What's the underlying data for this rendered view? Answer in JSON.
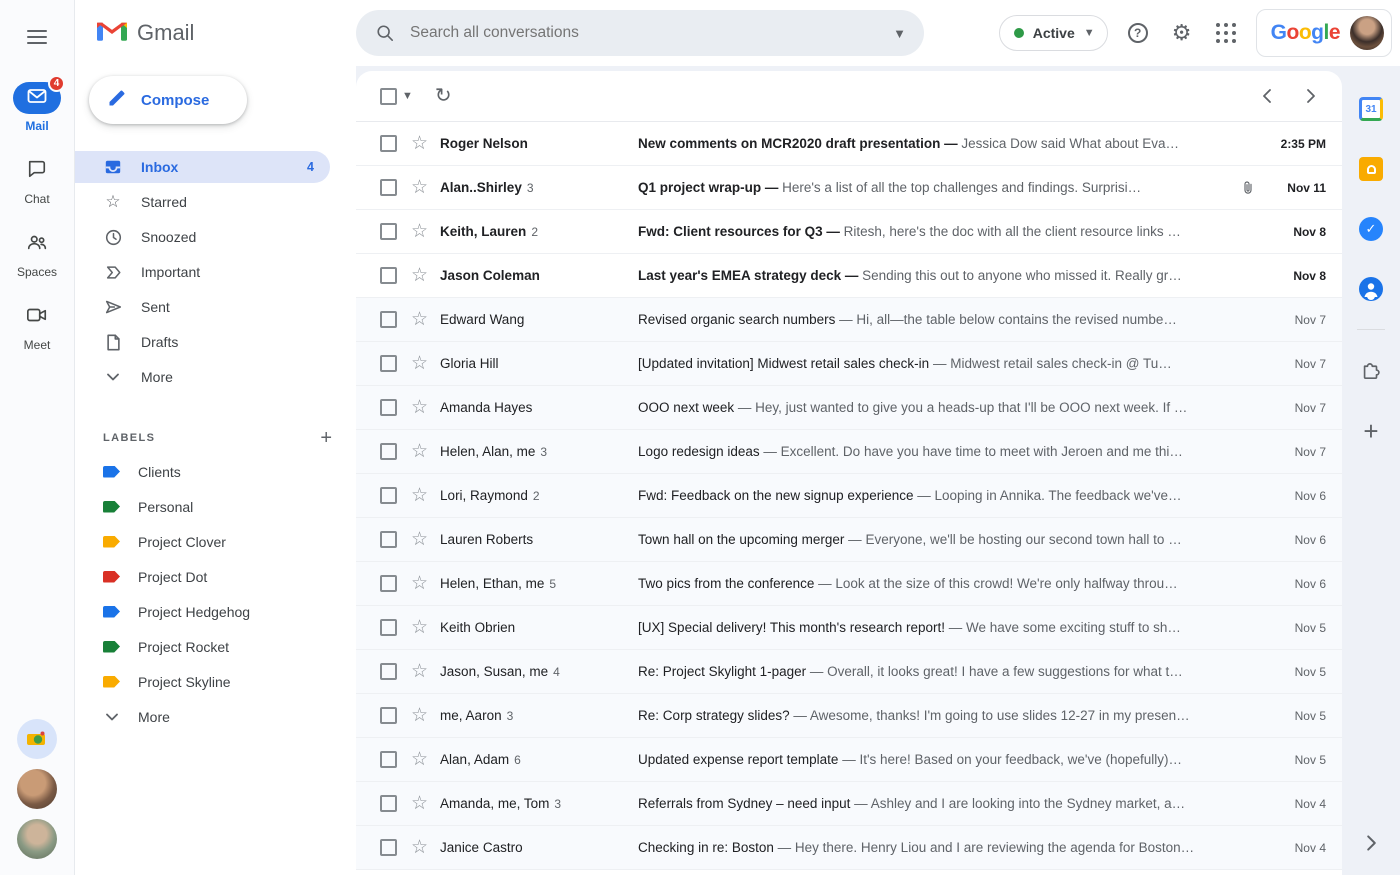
{
  "left_rail": {
    "nav": [
      {
        "id": "mail",
        "label": "Mail",
        "badge": "4",
        "active": true
      },
      {
        "id": "chat",
        "label": "Chat",
        "active": false
      },
      {
        "id": "spaces",
        "label": "Spaces",
        "active": false
      },
      {
        "id": "meet",
        "label": "Meet",
        "active": false
      }
    ]
  },
  "sidebar": {
    "brand": "Gmail",
    "compose_label": "Compose",
    "folders": [
      {
        "label": "Inbox",
        "count": "4",
        "active": true
      },
      {
        "label": "Starred"
      },
      {
        "label": "Snoozed"
      },
      {
        "label": "Important"
      },
      {
        "label": "Sent"
      },
      {
        "label": "Drafts"
      },
      {
        "label": "More"
      }
    ],
    "labels_header": "LABELS",
    "labels": [
      {
        "name": "Clients",
        "color": "#1a73e8"
      },
      {
        "name": "Personal",
        "color": "#188038"
      },
      {
        "name": "Project Clover",
        "color": "#f9ab00"
      },
      {
        "name": "Project Dot",
        "color": "#d93025"
      },
      {
        "name": "Project Hedgehog",
        "color": "#1a73e8"
      },
      {
        "name": "Project Rocket",
        "color": "#188038"
      },
      {
        "name": "Project Skyline",
        "color": "#f9ab00"
      }
    ],
    "labels_more": "More"
  },
  "header": {
    "search_placeholder": "Search all conversations",
    "status_label": "Active",
    "google_letters": [
      {
        "ch": "G",
        "color": "#4285f4"
      },
      {
        "ch": "o",
        "color": "#ea4335"
      },
      {
        "ch": "o",
        "color": "#fbbc05"
      },
      {
        "ch": "g",
        "color": "#4285f4"
      },
      {
        "ch": "l",
        "color": "#34a853"
      },
      {
        "ch": "e",
        "color": "#ea4335"
      }
    ]
  },
  "list": {
    "separator": "—",
    "emails": [
      {
        "sender": "Roger Nelson",
        "count": "",
        "subject": "New comments on MCR2020 draft presentation",
        "snippet": "Jessica Dow said What about Eva…",
        "date": "2:35 PM",
        "unread": true,
        "attachment": false
      },
      {
        "sender": "Alan..Shirley",
        "count": "3",
        "subject": "Q1 project wrap-up",
        "snippet": "Here's a list of all the top challenges and findings. Surprisi…",
        "date": "Nov 11",
        "unread": true,
        "attachment": true
      },
      {
        "sender": "Keith, Lauren",
        "count": "2",
        "subject": "Fwd: Client resources for Q3",
        "snippet": "Ritesh, here's the doc with all the client resource links …",
        "date": "Nov 8",
        "unread": true,
        "attachment": false
      },
      {
        "sender": "Jason Coleman",
        "count": "",
        "subject": "Last year's EMEA strategy deck",
        "snippet": "Sending this out to anyone who missed it. Really gr…",
        "date": "Nov 8",
        "unread": true,
        "attachment": false
      },
      {
        "sender": "Edward Wang",
        "count": "",
        "subject": "Revised organic search numbers",
        "snippet": "Hi, all—the table below contains the revised numbe…",
        "date": "Nov 7",
        "unread": false,
        "attachment": false
      },
      {
        "sender": "Gloria Hill",
        "count": "",
        "subject": "[Updated invitation] Midwest retail sales check-in",
        "snippet": "Midwest retail sales check-in @ Tu…",
        "date": "Nov 7",
        "unread": false,
        "attachment": false
      },
      {
        "sender": "Amanda Hayes",
        "count": "",
        "subject": "OOO next week",
        "snippet": "Hey, just wanted to give you a heads-up that I'll be OOO next week. If …",
        "date": "Nov 7",
        "unread": false,
        "attachment": false
      },
      {
        "sender": "Helen, Alan, me",
        "count": "3",
        "subject": "Logo redesign ideas",
        "snippet": "Excellent. Do have you have time to meet with Jeroen and me thi…",
        "date": "Nov 7",
        "unread": false,
        "attachment": false
      },
      {
        "sender": "Lori, Raymond",
        "count": "2",
        "subject": "Fwd: Feedback on the new signup experience",
        "snippet": "Looping in Annika. The feedback we've…",
        "date": "Nov 6",
        "unread": false,
        "attachment": false
      },
      {
        "sender": "Lauren Roberts",
        "count": "",
        "subject": "Town hall on the upcoming merger",
        "snippet": "Everyone, we'll be hosting our second town hall to …",
        "date": "Nov 6",
        "unread": false,
        "attachment": false
      },
      {
        "sender": "Helen, Ethan, me",
        "count": "5",
        "subject": "Two pics from the conference",
        "snippet": "Look at the size of this crowd! We're only halfway throu…",
        "date": "Nov 6",
        "unread": false,
        "attachment": false
      },
      {
        "sender": "Keith Obrien",
        "count": "",
        "subject": "[UX] Special delivery! This month's research report!",
        "snippet": "We have some exciting stuff to sh…",
        "date": "Nov 5",
        "unread": false,
        "attachment": false
      },
      {
        "sender": "Jason, Susan, me",
        "count": "4",
        "subject": "Re: Project Skylight 1-pager",
        "snippet": "Overall, it looks great! I have a few suggestions for what t…",
        "date": "Nov 5",
        "unread": false,
        "attachment": false
      },
      {
        "sender": "me, Aaron",
        "count": "3",
        "subject": "Re: Corp strategy slides?",
        "snippet": "Awesome, thanks! I'm going to use slides 12-27 in my presen…",
        "date": "Nov 5",
        "unread": false,
        "attachment": false
      },
      {
        "sender": "Alan, Adam",
        "count": "6",
        "subject": "Updated expense report template",
        "snippet": "It's here! Based on your feedback, we've (hopefully)…",
        "date": "Nov 5",
        "unread": false,
        "attachment": false
      },
      {
        "sender": "Amanda, me, Tom",
        "count": "3",
        "subject": "Referrals from Sydney – need input",
        "snippet": "Ashley and I are looking into the Sydney market, a…",
        "date": "Nov 4",
        "unread": false,
        "attachment": false
      },
      {
        "sender": "Janice Castro",
        "count": "",
        "subject": "Checking in re: Boston",
        "snippet": "Hey there. Henry Liou and I are reviewing the agenda for Boston…",
        "date": "Nov 4",
        "unread": false,
        "attachment": false
      }
    ]
  },
  "right_rail": {
    "calendar_text": "31",
    "tasks_glyph": "✓",
    "icons": [
      "calendar-icon",
      "keep-icon",
      "tasks-icon",
      "contacts-icon",
      "addons-puzzle-icon",
      "add-panel-icon",
      "expand-panel-icon"
    ]
  }
}
